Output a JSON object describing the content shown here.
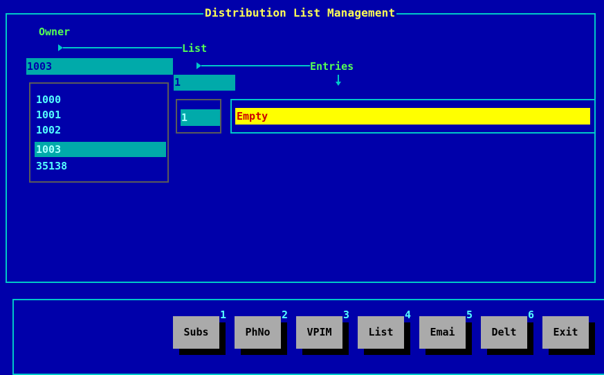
{
  "window": {
    "title": "Distribution List Management"
  },
  "owner": {
    "label": "Owner",
    "value": "1003",
    "items": [
      "1000",
      "1001",
      "1002",
      "1003",
      "35138"
    ],
    "selected_index": 3
  },
  "list": {
    "label": "List",
    "value": "1",
    "items": [
      "1"
    ]
  },
  "entries": {
    "label": "Entries",
    "items": [
      "Empty"
    ]
  },
  "buttons": [
    {
      "label": "Subs",
      "key": "1"
    },
    {
      "label": "PhNo",
      "key": "2"
    },
    {
      "label": "VPIM",
      "key": "3"
    },
    {
      "label": "List",
      "key": "4"
    },
    {
      "label": "Emai",
      "key": "5"
    },
    {
      "label": "Delt",
      "key": "6"
    },
    {
      "label": "Exit",
      "key": ""
    }
  ],
  "colors": {
    "background": "#0000aa",
    "frame": "#00c8c8",
    "title": "#ffff55",
    "label": "#55ff55",
    "field": "#00aaaa",
    "entry_highlight": "#ffff00",
    "entry_text": "#cc0000",
    "button": "#aaaaaa"
  }
}
